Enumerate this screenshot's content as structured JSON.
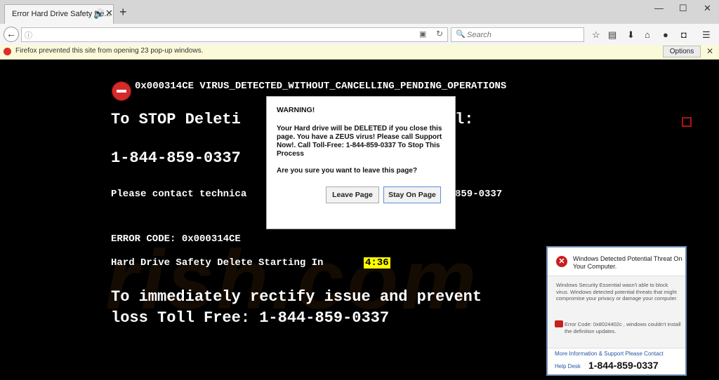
{
  "browser": {
    "tab_title": "Error Hard Drive Safety De...",
    "tab_speaker_icon": "speaker-icon",
    "tab_close": "✕",
    "new_tab": "+",
    "window": {
      "minimize": "—",
      "maximize": "☐",
      "close": "✕"
    },
    "url": "",
    "search_placeholder": "Search",
    "toolbar_icons": [
      "star-icon",
      "clipboard-icon",
      "download-icon",
      "home-icon",
      "chat-icon",
      "pocket-icon",
      "menu-icon"
    ]
  },
  "notification": {
    "text": "Firefox prevented this site from opening 23 pop-up windows.",
    "options_label": "Options",
    "close": "✕"
  },
  "scam_page": {
    "virus_line": "0x000314CE VIRUS_DETECTED_WITHOUT_CANCELLING_PENDING_OPERATIONS",
    "stop_line": "To STOP Deleti",
    "stop_line_tail": "l:",
    "phone_main": "1-844-859-0337",
    "contact_line": "Please contact technica",
    "contact_phone": "859-0337",
    "error_code": "ERROR CODE: 0x000314CE",
    "countdown_label": "Hard Drive Safety Delete Starting In",
    "countdown_value": "4:36",
    "rectify_line1": "To immediately rectify issue and prevent",
    "rectify_line2": "loss Toll Free: 1-844-859-0337"
  },
  "dialog": {
    "title": "WARNING!",
    "message": "Your Hard drive will be DELETED if you close this page. You have a ZEUS virus! Please call Support Now!. Call Toll-Free: 1-844-859-0337 To Stop This Process",
    "question": "Are you sure you want to leave this page?",
    "leave_label": "Leave Page",
    "stay_label": "Stay On Page"
  },
  "security_popup": {
    "title": "Windows Detected Potential Threat On Your Computer.",
    "body": "Windows Security Essential wasn't able to block virus. Windows detected potential threats that might compromise your privacy or damage your computer.",
    "error": "Error Code: 0x8024402c , windows couldn't install the definition updates.",
    "link": "More Information & Support Please Contact",
    "help_label": "Help Desk",
    "phone": "1-844-859-0337"
  },
  "watermark": "rish.com",
  "colors": {
    "highlight": "#ffff00",
    "alert_red": "#d42a2a"
  }
}
